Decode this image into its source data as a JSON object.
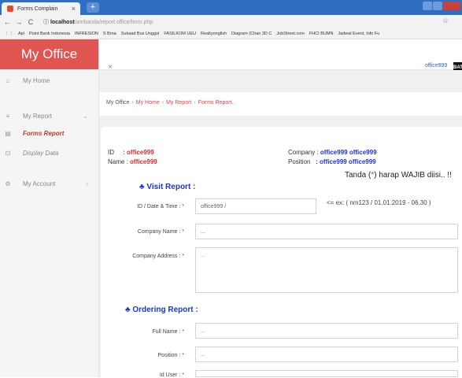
{
  "browser": {
    "tab_title": "Forms Complain",
    "tab_close": "×",
    "new_tab": "+",
    "url_host": "localhost",
    "url_path": "/ambanda/report office/form.php",
    "bookmarks": [
      "Apl",
      "Point Bank Indonesia",
      "INFRESION",
      "S Brna",
      "Sukaad Bus Unggul",
      "FASILKOM UEU",
      "Realtyonglish",
      "Diagram (Chan 3D C",
      "JobStreet.com",
      "FHCI BUMN",
      "Jadwal Event, Info Fu"
    ]
  },
  "sidebar": {
    "brand": "My Office",
    "items": [
      {
        "label": "My Home",
        "icon": "⌂",
        "chevron": ""
      },
      {
        "label": "My Report",
        "icon": "≡",
        "chevron": "⌄"
      },
      {
        "label": "Forms Report",
        "icon": "▤",
        "chevron": ""
      },
      {
        "label": "Display Data",
        "icon": "⊡",
        "chevron": ""
      },
      {
        "label": "My Account",
        "icon": "⚙",
        "chevron": "‹"
      }
    ]
  },
  "header": {
    "toggle": "×",
    "user": "office999",
    "avatar_text": "BAT"
  },
  "breadcrumb": {
    "root": "My Office",
    "items": [
      "My Home",
      "My Report",
      "Forms Report.."
    ],
    "separator": "›"
  },
  "info": {
    "id_label": "ID",
    "id_value": ": office999",
    "name_label": "Name :",
    "name_value": "office999",
    "company_label": "Company :",
    "company_value": "office999 office999",
    "position_label": "Position",
    "position_value": ": office999 office999"
  },
  "notice": {
    "prefix": "Tanda (",
    "mark": "*",
    "suffix": ") harap WAJIB diisi.. !!"
  },
  "visit_section": {
    "title": "♣ Visit Report :",
    "fields": [
      {
        "label": "ID / Date & Time :",
        "value": "office999 /"
      },
      {
        "label": "Company Name :",
        "value": "..."
      },
      {
        "label": "Company Address :",
        "value": "..."
      }
    ],
    "hint": "<= ex: ( nm123 / 01.01.2019 - 06.30 )"
  },
  "ordering_section": {
    "title": "♣ Ordering Report :",
    "fields": [
      {
        "label": "Full Name :",
        "value": "..."
      },
      {
        "label": "Position :",
        "value": "..."
      },
      {
        "label": "Id User :",
        "value": ""
      }
    ]
  },
  "required_mark": "*"
}
